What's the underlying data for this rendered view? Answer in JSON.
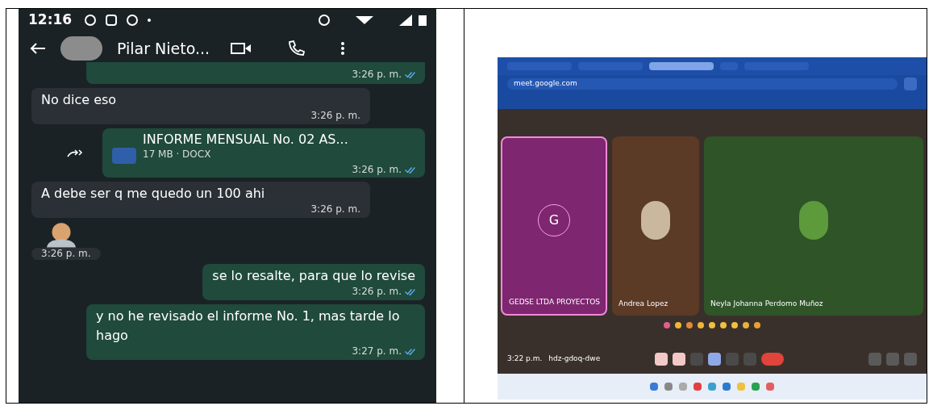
{
  "phone": {
    "status_bar": {
      "time": "12:16"
    },
    "chat_header": {
      "contact_name": "Pilar Nieto..."
    },
    "messages": [
      {
        "kind": "cut",
        "time": "3:26 p. m.",
        "read": true
      },
      {
        "kind": "in",
        "text": "No dice eso",
        "time": "3:26 p. m."
      },
      {
        "kind": "document",
        "file_name": "INFORME MENSUAL No. 02 AS...",
        "file_info": "17 MB · DOCX",
        "time": "3:26 p. m.",
        "read": true
      },
      {
        "kind": "in",
        "text": "A debe ser q me quedo un 100 ahi",
        "time": "3:26 p. m."
      },
      {
        "kind": "sticker",
        "time": "3:26 p. m."
      },
      {
        "kind": "out",
        "text": "se lo resalte, para que lo revise",
        "time": "3:26 p. m.",
        "read": true
      },
      {
        "kind": "out",
        "text": "y no he revisado el informe No. 1, mas tarde lo hago",
        "time": "3:27 p. m.",
        "read": true
      }
    ]
  },
  "meet": {
    "browser_tabs": [
      {
        "selected": false
      },
      {
        "selected": false
      },
      {
        "selected": true
      },
      {
        "selected": false
      },
      {
        "selected": false
      }
    ],
    "address_bar": {
      "url": "meet.google.com"
    },
    "tiles": [
      {
        "kind": "initial",
        "initial": "G",
        "name": "GEDSE LTDA PROYECTOS",
        "color": "#7e2670",
        "highlighted": true
      },
      {
        "kind": "photo",
        "name": "Andrea Lopez",
        "color": "#5b3a26",
        "highlighted": false
      },
      {
        "kind": "photo",
        "name": "Neyla Johanna Perdomo Muñoz",
        "color": "#2e5428",
        "highlighted": false
      }
    ],
    "control_bar": {
      "time": "3:22 p.m.",
      "meeting_code": "hdz-gdoq-dwe"
    }
  }
}
